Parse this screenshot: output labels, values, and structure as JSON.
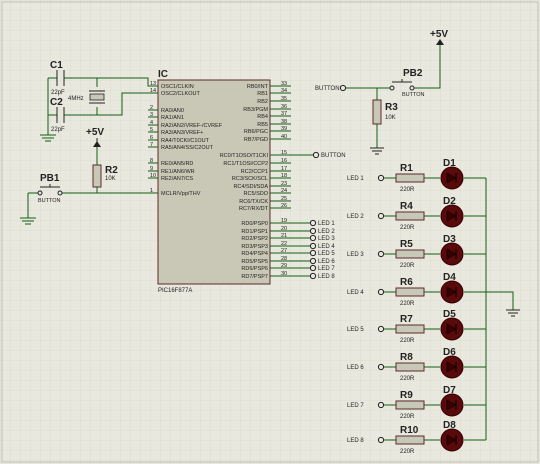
{
  "supply": {
    "label": "+5V"
  },
  "ic": {
    "ref": "IC",
    "part": "PIC16F877A",
    "left_pins": [
      {
        "num": "13",
        "name": "OSC1/CLKIN"
      },
      {
        "num": "14",
        "name": "OSC2/CLKOUT"
      },
      {
        "num": "2",
        "name": "RA0/AN0"
      },
      {
        "num": "3",
        "name": "RA1/AN1"
      },
      {
        "num": "4",
        "name": "RA2/AN2/VREF-/CVREF"
      },
      {
        "num": "5",
        "name": "RA3/AN3/VREF+"
      },
      {
        "num": "6",
        "name": "RA4/T0CKI/C1OUT"
      },
      {
        "num": "7",
        "name": "RA5/AN4/SS/C2OUT"
      },
      {
        "num": "8",
        "name": "RE0/AN5/RD"
      },
      {
        "num": "9",
        "name": "RE1/AN6/WR"
      },
      {
        "num": "10",
        "name": "RE2/AN7/CS"
      },
      {
        "num": "1",
        "name": "MCLR/Vpp/THV"
      }
    ],
    "right_pins": [
      {
        "num": "33",
        "name": "RB0/INT"
      },
      {
        "num": "34",
        "name": "RB1"
      },
      {
        "num": "35",
        "name": "RB2"
      },
      {
        "num": "36",
        "name": "RB3/PGM"
      },
      {
        "num": "37",
        "name": "RB4"
      },
      {
        "num": "38",
        "name": "RB5"
      },
      {
        "num": "39",
        "name": "RB6/PGC"
      },
      {
        "num": "40",
        "name": "RB7/PGD"
      },
      {
        "num": "15",
        "name": "RC0/T1OSO/T1CKI"
      },
      {
        "num": "16",
        "name": "RC1/T1OSI/CCP2"
      },
      {
        "num": "17",
        "name": "RC2/CCP1"
      },
      {
        "num": "18",
        "name": "RC3/SCK/SCL"
      },
      {
        "num": "23",
        "name": "RC4/SDI/SDA"
      },
      {
        "num": "24",
        "name": "RC5/SDO"
      },
      {
        "num": "25",
        "name": "RC6/TX/CK"
      },
      {
        "num": "26",
        "name": "RC7/RX/DT"
      },
      {
        "num": "19",
        "name": "RD0/PSP0"
      },
      {
        "num": "20",
        "name": "RD1/PSP1"
      },
      {
        "num": "21",
        "name": "RD2/PSP2"
      },
      {
        "num": "22",
        "name": "RD3/PSP3"
      },
      {
        "num": "27",
        "name": "RD4/PSP4"
      },
      {
        "num": "28",
        "name": "RD5/PSP5"
      },
      {
        "num": "29",
        "name": "RD6/PSP6"
      },
      {
        "num": "30",
        "name": "RD7/PSP7"
      }
    ]
  },
  "c1": {
    "ref": "C1",
    "value": "22pF"
  },
  "c2": {
    "ref": "C2",
    "value": "22pF"
  },
  "crystal": {
    "value": "4MHz"
  },
  "r2": {
    "ref": "R2",
    "value": "10K"
  },
  "pb1": {
    "ref": "PB1",
    "value": "BUTTON"
  },
  "r3": {
    "ref": "R3",
    "value": "10K"
  },
  "pb2": {
    "ref": "PB2",
    "value": "BUTTON"
  },
  "net_button_in": "BUTTON",
  "net_button_out": "BUTTON",
  "ic_led_nets": [
    "LED 1",
    "LED 2",
    "LED 3",
    "LED 4",
    "LED 5",
    "LED 6",
    "LED 7",
    "LED 8"
  ],
  "led_rows": [
    {
      "net": "LED 1",
      "res": "R1",
      "value": "220R",
      "led": "D1"
    },
    {
      "net": "LED 2",
      "res": "R4",
      "value": "220R",
      "led": "D2"
    },
    {
      "net": "LED 3",
      "res": "R5",
      "value": "220R",
      "led": "D3"
    },
    {
      "net": "LED 4",
      "res": "R6",
      "value": "220R",
      "led": "D4"
    },
    {
      "net": "LED 5",
      "res": "R7",
      "value": "220R",
      "led": "D5"
    },
    {
      "net": "LED 6",
      "res": "R8",
      "value": "220R",
      "led": "D6"
    },
    {
      "net": "LED 7",
      "res": "R9",
      "value": "220R",
      "led": "D7"
    },
    {
      "net": "LED 8",
      "res": "R10",
      "value": "220R",
      "led": "D8"
    }
  ]
}
